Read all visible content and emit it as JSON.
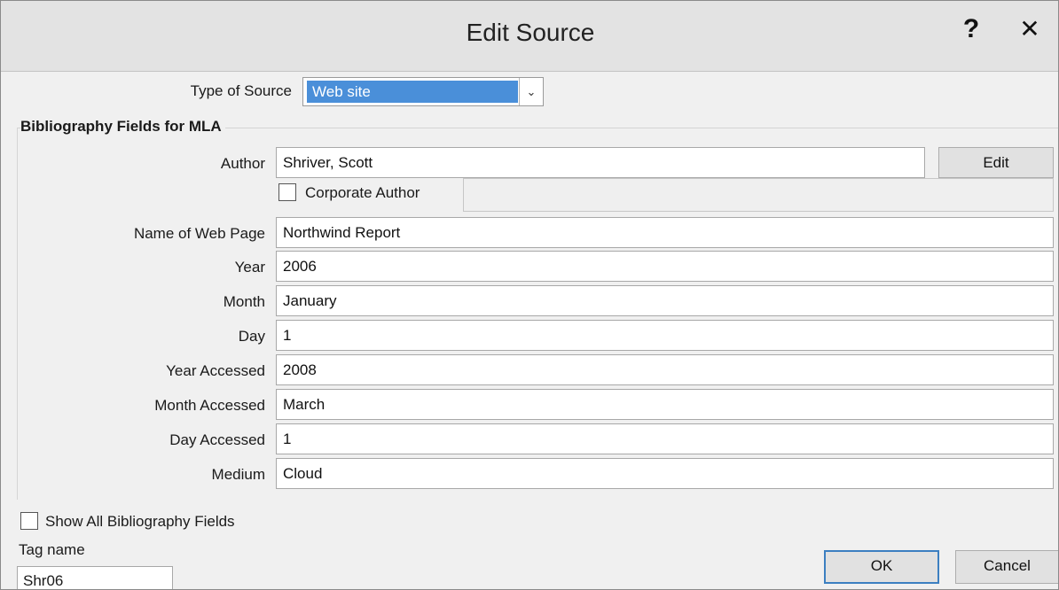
{
  "window": {
    "title": "Edit Source",
    "help_glyph": "?",
    "close_glyph": "✕"
  },
  "type_of_source": {
    "label": "Type of Source",
    "value": "Web site"
  },
  "group": {
    "label": "Bibliography Fields for MLA"
  },
  "author": {
    "label": "Author",
    "value": "Shriver, Scott",
    "edit_button": "Edit",
    "corporate_label": "Corporate Author",
    "corporate_checked": false
  },
  "fields": [
    {
      "label": "Name of Web Page",
      "value": "Northwind Report"
    },
    {
      "label": "Year",
      "value": "2006"
    },
    {
      "label": "Month",
      "value": "January"
    },
    {
      "label": "Day",
      "value": "1"
    },
    {
      "label": "Year Accessed",
      "value": "2008"
    },
    {
      "label": "Month Accessed",
      "value": "March"
    },
    {
      "label": "Day Accessed",
      "value": "1"
    },
    {
      "label": "Medium",
      "value": "Cloud"
    }
  ],
  "show_all": {
    "label": "Show All Bibliography Fields",
    "checked": false
  },
  "tag": {
    "label": "Tag name",
    "value": "Shr06"
  },
  "buttons": {
    "ok": "OK",
    "cancel": "Cancel"
  }
}
